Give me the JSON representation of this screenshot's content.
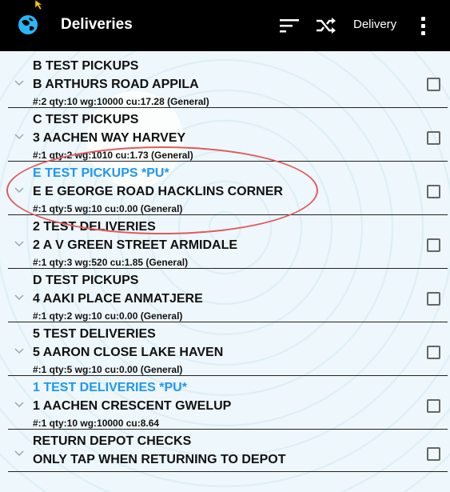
{
  "appbar": {
    "title": "Deliveries",
    "mode_label": "Delivery",
    "icons": [
      "globe-logo-icon",
      "sort-icon",
      "shuffle-icon",
      "more-vert-icon"
    ]
  },
  "colors": {
    "accent_pu": "#2196f3",
    "annotation_circle": "#e05a5a"
  },
  "items": [
    {
      "line1": "B TEST PICKUPS",
      "line2": "B ARTHURS ROAD APPILA",
      "line3": "#:2 qty:10 wg:10000 cu:17.28 (General)",
      "pu": false,
      "checked": false
    },
    {
      "line1": "C TEST PICKUPS",
      "line2": "3 AACHEN WAY HARVEY",
      "line3": "#:1 qty:2 wg:1010 cu:1.73 (General)",
      "pu": false,
      "checked": false
    },
    {
      "line1": "E TEST PICKUPS *PU*",
      "line2": "E E GEORGE ROAD HACKLINS CORNER",
      "line3": "#:1 qty:5 wg:10 cu:0.00 (General)",
      "pu": true,
      "checked": false
    },
    {
      "line1": "2 TEST DELIVERIES",
      "line2": "2 A V GREEN STREET ARMIDALE",
      "line3": "#:1 qty:3 wg:520 cu:1.85 (General)",
      "pu": false,
      "checked": false
    },
    {
      "line1": "D TEST PICKUPS",
      "line2": "4 AAKI PLACE ANMATJERE",
      "line3": "#:1 qty:2 wg:10 cu:0.00 (General)",
      "pu": false,
      "checked": false
    },
    {
      "line1": "5 TEST DELIVERIES",
      "line2": "5 AARON CLOSE LAKE HAVEN",
      "line3": "#:1 qty:5 wg:10 cu:0.00 (General)",
      "pu": false,
      "checked": false
    },
    {
      "line1": "1 TEST DELIVERIES *PU*",
      "line2": "1 AACHEN CRESCENT GWELUP",
      "line3": "#:1 qty:10 wg:10000 cu:8.64",
      "pu": true,
      "checked": false
    },
    {
      "line1": "RETURN DEPOT CHECKS",
      "line2": "ONLY TAP WHEN RETURNING TO DEPOT",
      "line3": "",
      "pu": false,
      "checked": false
    }
  ]
}
